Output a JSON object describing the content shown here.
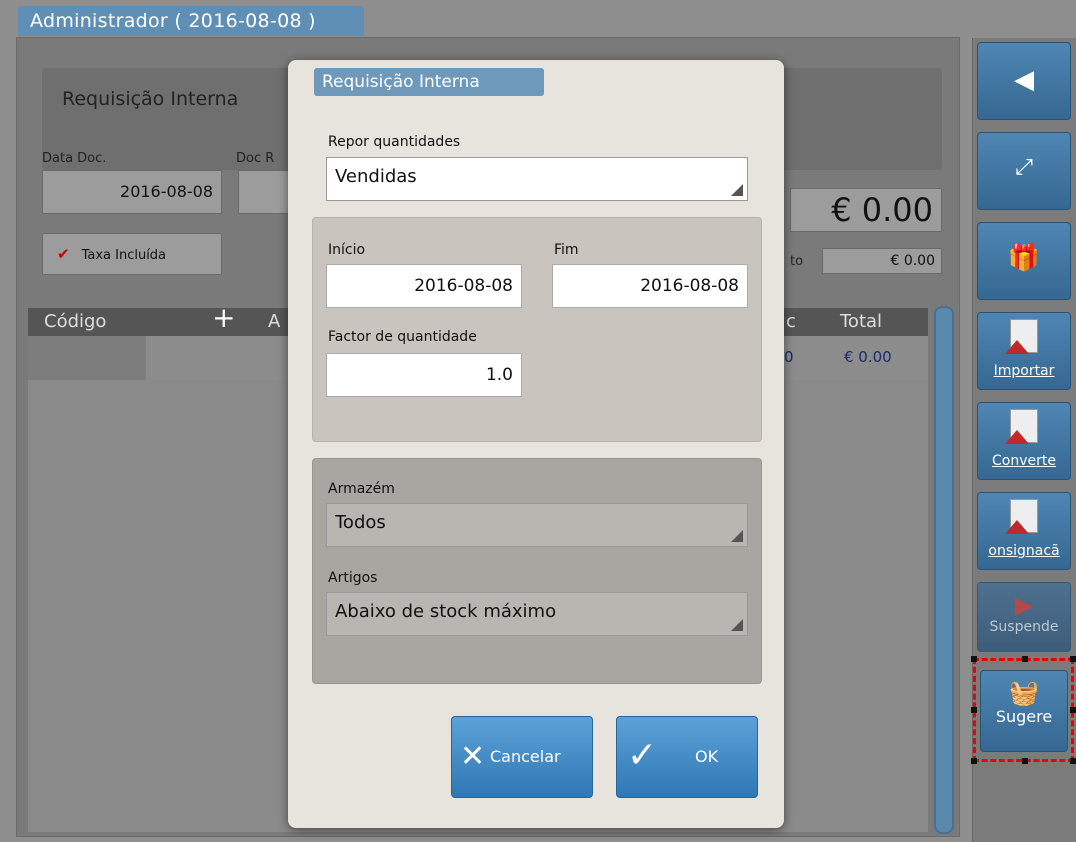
{
  "window": {
    "title": "Administrador ( 2016-08-08 )"
  },
  "document": {
    "title": "Requisição Interna",
    "date_label": "Data Doc.",
    "date_value": "2016-08-08",
    "docref_label": "Doc R",
    "tax_checkbox": {
      "label": "Taxa Incluída",
      "checked": true
    },
    "total": "€ 0.00",
    "subtotal_label": "to",
    "subtotal_value": "€ 0.00"
  },
  "grid": {
    "columns": [
      "Código",
      "A",
      "c",
      "Total"
    ],
    "rows": [
      {
        "qty_fragment": "0",
        "total": "€ 0.00"
      }
    ]
  },
  "sidebar": {
    "buttons": [
      {
        "icon": "back-arrow-icon",
        "label": ""
      },
      {
        "icon": "expand-icon",
        "label": ""
      },
      {
        "icon": "gift-icon",
        "label": ""
      },
      {
        "icon": "import-document-icon",
        "label": "Importar"
      },
      {
        "icon": "convert-document-icon",
        "label": "Converte"
      },
      {
        "icon": "consignment-document-icon",
        "label": "onsignacã"
      },
      {
        "icon": "suspend-arrow-icon",
        "label": "Suspende"
      },
      {
        "icon": "basket-icon",
        "label": "Sugere"
      }
    ]
  },
  "dialog": {
    "title": "Requisição Interna",
    "repor_label": "Repor quantidades",
    "repor_value": "Vendidas",
    "inicio_label": "Início",
    "inicio_value": "2016-08-08",
    "fim_label": "Fim",
    "fim_value": "2016-08-08",
    "factor_label": "Factor de quantidade",
    "factor_value": "1.0",
    "armazem_label": "Armazém",
    "armazem_value": "Todos",
    "artigos_label": "Artigos",
    "artigos_value": "Abaixo de stock máximo",
    "cancel_label": "Cancelar",
    "ok_label": "OK"
  },
  "colors": {
    "accent": "#5f8fb5",
    "highlight": "#e00000",
    "check": "#cc0000"
  }
}
